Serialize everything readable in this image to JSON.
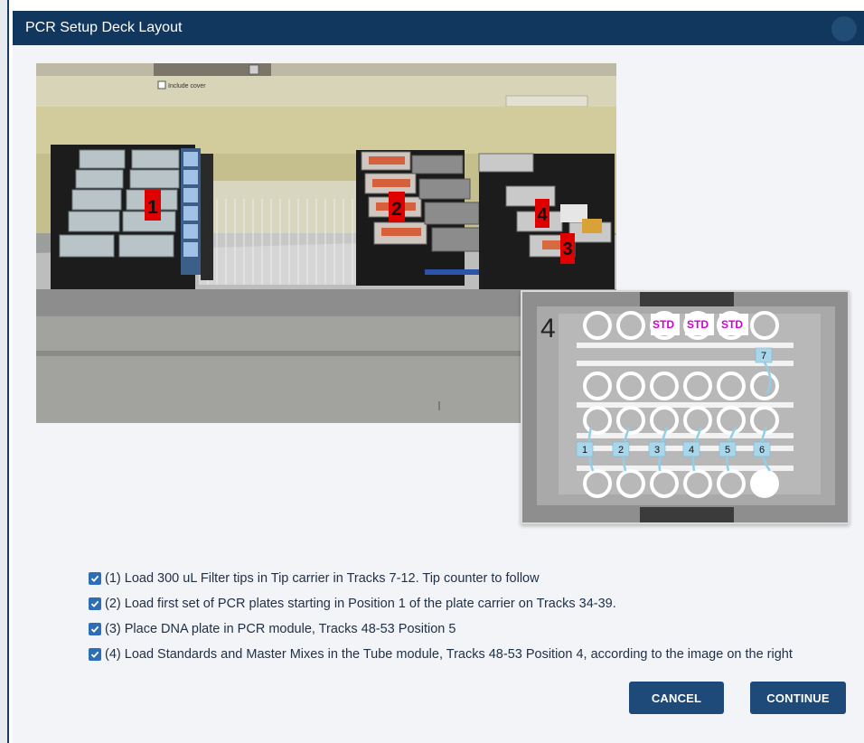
{
  "dialog": {
    "title": "PCR Setup Deck Layout"
  },
  "deck_photo": {
    "position_markers": [
      "1",
      "2",
      "4",
      "3"
    ],
    "include_cover_label": "Include cover"
  },
  "tube_module": {
    "module_number": "4",
    "std_labels": [
      "STD",
      "STD",
      "STD"
    ],
    "tube_numbers": [
      "1",
      "2",
      "3",
      "4",
      "5",
      "6",
      "7"
    ]
  },
  "checklist": {
    "items": [
      {
        "label": "(1) Load 300 uL Filter tips in Tip carrier in Tracks 7-12. Tip counter to follow",
        "checked": true
      },
      {
        "label": "(2) Load first set of PCR plates starting in Position 1 of the plate carrier on Tracks 34-39.",
        "checked": true
      },
      {
        "label": "(3)  Place DNA plate in PCR module, Tracks 48-53 Position 5",
        "checked": true
      },
      {
        "label": "(4) Load Standards and Master Mixes in the Tube module, Tracks 48-53 Position 4, according to the image on the right",
        "checked": true
      }
    ]
  },
  "buttons": {
    "cancel_label": "CANCEL",
    "continue_label": "CONTINUE"
  },
  "colors": {
    "titlebar": "#12375e",
    "button": "#1d4a78",
    "checkbox": "#2d6fb7",
    "marker_red": "#e00000",
    "std_magenta": "#d000d0",
    "tube_label_blue": "#a8d6ea"
  }
}
